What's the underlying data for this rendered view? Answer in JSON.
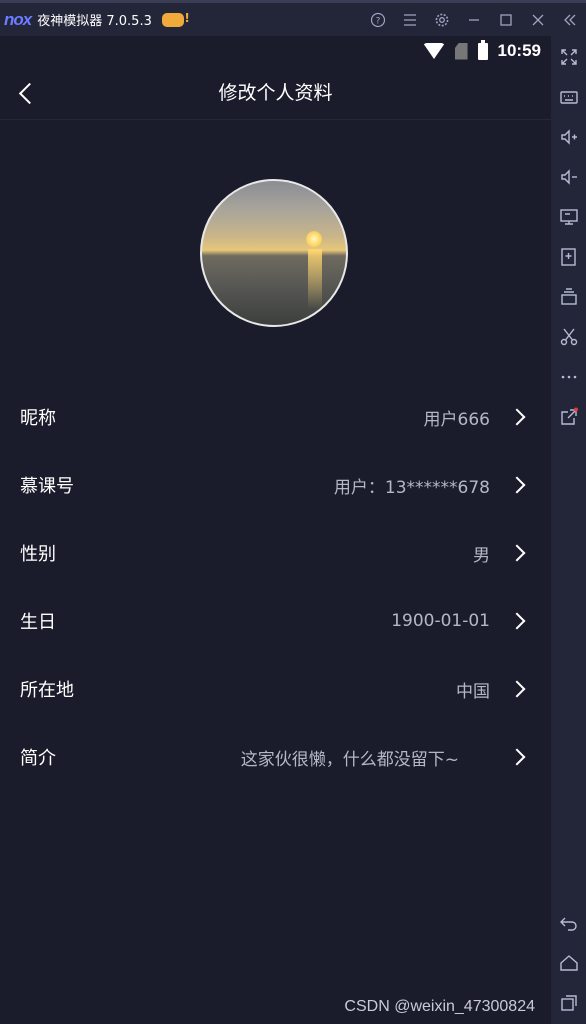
{
  "emulator": {
    "logo": "nox",
    "title": "夜神模拟器 7.0.5.3",
    "controls": [
      "help-icon",
      "menu-icon",
      "settings-icon",
      "minimize-icon",
      "maximize-icon",
      "close-icon",
      "collapse-icon"
    ]
  },
  "statusbar": {
    "time": "10:59"
  },
  "navbar": {
    "title": "修改个人资料"
  },
  "profile": {
    "rows": [
      {
        "label": "昵称",
        "value": "用户666"
      },
      {
        "label": "慕课号",
        "value": "用户：13******678"
      },
      {
        "label": "性别",
        "value": "男"
      },
      {
        "label": "生日",
        "value": "1900-01-01"
      },
      {
        "label": "所在地",
        "value": "中国"
      },
      {
        "label": "简介",
        "value": "这家伙很懒，什么都没留下~"
      }
    ]
  },
  "watermark": "CSDN @weixin_47300824",
  "sidebar": {
    "icons": [
      "fullscreen-icon",
      "keyboard-icon",
      "volume-up-icon",
      "volume-down-icon",
      "screen-icon",
      "apk-install-icon",
      "multi-instance-icon",
      "scissors-icon",
      "more-icon",
      "share-icon",
      "back-icon",
      "home-icon",
      "recent-apps-icon"
    ]
  },
  "colors": {
    "background": "#1b1c2b",
    "toolbar": "#232539",
    "value_text": "#b5b7c6"
  }
}
